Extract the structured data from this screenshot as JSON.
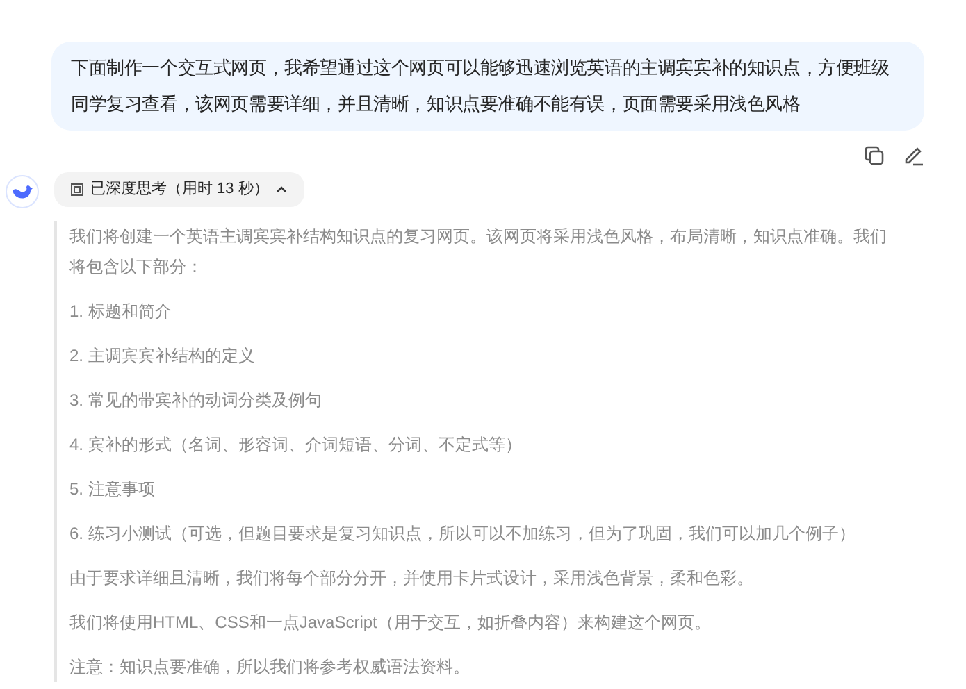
{
  "user_message": {
    "text": "下面制作一个交互式网页，我希望通过这个网页可以能够迅速浏览英语的主调宾宾补的知识点，方便班级同学复习查看，该网页需要详细，并且清晰，知识点要准确不能有误，页面需要采用浅色风格"
  },
  "thinking": {
    "label": "已深度思考（用时 13 秒）",
    "expanded": true,
    "paragraphs": [
      "我们将创建一个英语主调宾宾补结构知识点的复习网页。该网页将采用浅色风格，布局清晰，知识点准确。我们将包含以下部分：",
      "1. 标题和简介",
      "2. 主调宾宾补结构的定义",
      "3. 常见的带宾补的动词分类及例句",
      "4. 宾补的形式（名词、形容词、介词短语、分词、不定式等）",
      "5. 注意事项",
      "6. 练习小测试（可选，但题目要求是复习知识点，所以可以不加练习，但为了巩固，我们可以加几个例子）",
      "由于要求详细且清晰，我们将每个部分分开，并使用卡片式设计，采用浅色背景，柔和色彩。",
      "我们将使用HTML、CSS和一点JavaScript（用于交互，如折叠内容）来构建这个网页。",
      "注意：知识点要准确，所以我们将参考权威语法资料。"
    ]
  }
}
